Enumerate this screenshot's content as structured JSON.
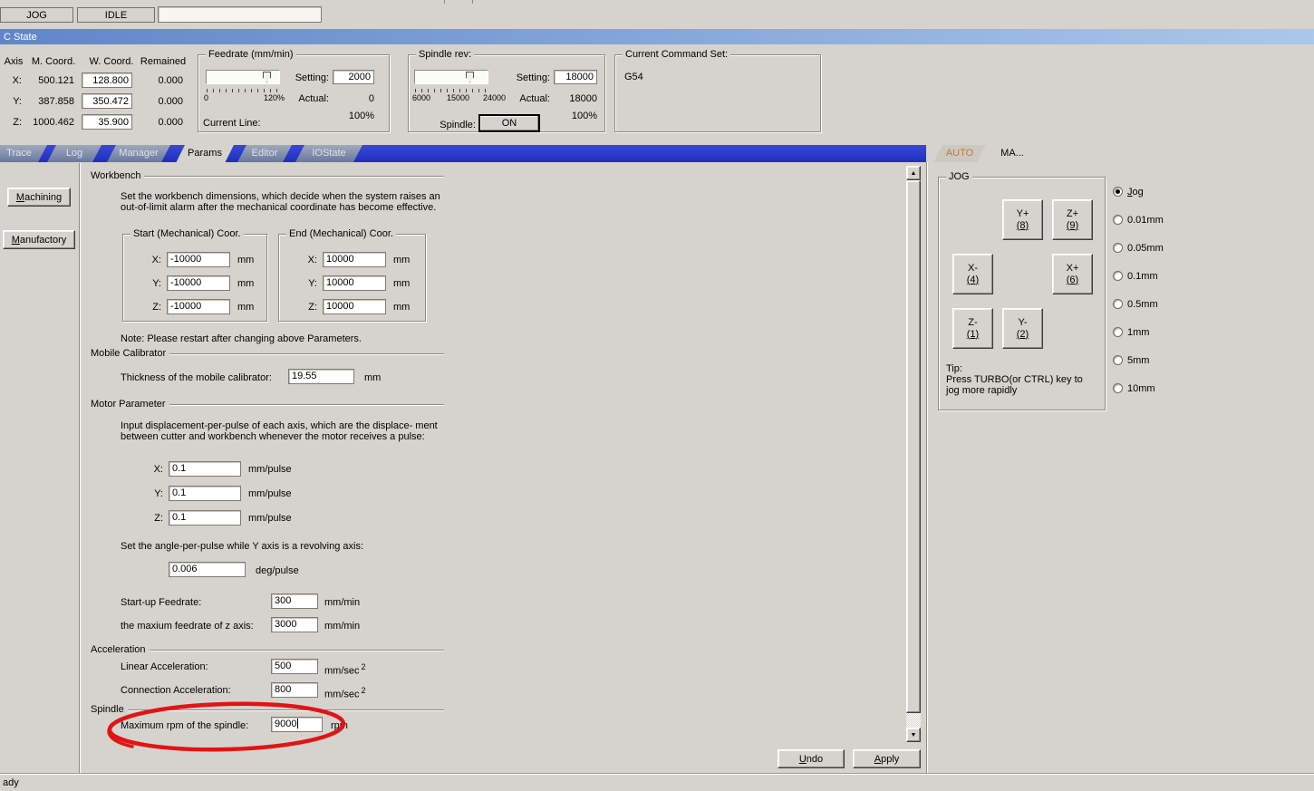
{
  "topbar": {
    "jog": "JOG",
    "idle": "IDLE",
    "input": ""
  },
  "titlebar": {
    "title": "C State"
  },
  "coord_panel": {
    "headers": {
      "axis": "Axis",
      "m": "M. Coord.",
      "w": "W. Coord.",
      "r": "Remained"
    },
    "rows": [
      {
        "axis": "X:",
        "m": "500.121",
        "w": "128.800",
        "r": "0.000"
      },
      {
        "axis": "Y:",
        "m": "387.858",
        "w": "350.472",
        "r": "0.000"
      },
      {
        "axis": "Z:",
        "m": "1000.462",
        "w": "35.900",
        "r": "0.000"
      }
    ]
  },
  "feedrate": {
    "group": "Feedrate (mm/min)",
    "setting_label": "Setting:",
    "setting": "2000",
    "actual_label": "Actual:",
    "actual": "0",
    "percent": "100%",
    "scale_min": "0",
    "scale_max": "120%",
    "current_line": "Current Line:"
  },
  "spindle_panel": {
    "group": "Spindle rev:",
    "setting_label": "Setting:",
    "setting": "18000",
    "actual_label": "Actual:",
    "actual": "18000",
    "percent": "100%",
    "scale": [
      "6000",
      "15000",
      "24000"
    ],
    "spindle_label": "Spindle:",
    "on": "ON"
  },
  "command": {
    "group": "Current Command Set:",
    "value": "G54"
  },
  "tabs": [
    {
      "label": "Trace"
    },
    {
      "label": "Log"
    },
    {
      "label": "Manager"
    },
    {
      "label": "Params",
      "active": true
    },
    {
      "label": "Editor"
    },
    {
      "label": "IOState"
    }
  ],
  "sidebar": {
    "machining": "Machining",
    "manufactory": "Manufactory"
  },
  "params": {
    "workbench": {
      "title": "Workbench",
      "desc1": "Set the workbench dimensions, which decide when the system raises an",
      "desc2": "out-of-limit alarm after the mechanical coordinate has become effective.",
      "start_group": "Start (Mechanical) Coor.",
      "end_group": "End (Mechanical) Coor.",
      "axis_labels": [
        "X:",
        "Y:",
        "Z:"
      ],
      "start_values": [
        "-10000",
        "-10000",
        "-10000"
      ],
      "end_values": [
        "10000",
        "10000",
        "10000"
      ],
      "unit": "mm",
      "note": "Note: Please restart after changing above Parameters."
    },
    "calibrator": {
      "title": "Mobile Calibrator",
      "label": "Thickness of the mobile calibrator:",
      "value": "19.55",
      "unit": "mm"
    },
    "motor": {
      "title": "Motor Parameter",
      "desc1": "Input displacement-per-pulse of each axis, which are the displace- ment",
      "desc2": "between cutter and workbench whenever the motor receives a pulse:",
      "axis_labels": [
        "X:",
        "Y:",
        "Z:"
      ],
      "values": [
        "0.1",
        "0.1",
        "0.1"
      ],
      "unit": "mm/pulse",
      "angle_label": "Set the angle-per-pulse while Y axis is a revolving axis:",
      "angle_value": "0.006",
      "angle_unit": "deg/pulse",
      "startup_label": "Start-up Feedrate:",
      "startup_value": "300",
      "startup_unit": "mm/min",
      "zmax_label": "the maxium feedrate of z axis:",
      "zmax_value": "3000",
      "zmax_unit": "mm/min"
    },
    "acceleration": {
      "title": "Acceleration",
      "linear_label": "Linear Acceleration:",
      "linear_value": "500",
      "connection_label": "Connection Acceleration:",
      "connection_value": "800",
      "unit": "mm/sec",
      "unit_sup": "2"
    },
    "spindle": {
      "title": "Spindle",
      "label": "Maximum rpm of the spindle:",
      "value": "9000",
      "unit": "rpm"
    },
    "undo": "Undo",
    "apply": "Apply"
  },
  "right_panel": {
    "tabs": [
      {
        "label": "AUTO"
      },
      {
        "label": "MA...",
        "active": true
      }
    ],
    "jog": {
      "group": "JOG",
      "buttons": [
        {
          "axis": "Y+",
          "key": "(8)"
        },
        {
          "axis": "Z+",
          "key": "(9)"
        },
        {
          "axis": "X-",
          "key": "(4)"
        },
        {
          "axis": "X+",
          "key": "(6)"
        },
        {
          "axis": "Z-",
          "key": "(1)"
        },
        {
          "axis": "Y-",
          "key": "(2)"
        }
      ],
      "tip1": "Tip:",
      "tip2": "Press TURBO(or CTRL) key to",
      "tip3": "jog more rapidly"
    },
    "steps": [
      {
        "label": "Jog",
        "selected": true
      },
      {
        "label": "0.01mm"
      },
      {
        "label": "0.05mm"
      },
      {
        "label": "0.1mm"
      },
      {
        "label": "0.5mm"
      },
      {
        "label": "1mm"
      },
      {
        "label": "5mm"
      },
      {
        "label": "10mm"
      }
    ]
  },
  "statusbar": {
    "text": "ady"
  },
  "colors": {
    "annotation": "#e11414",
    "tabbar_blue": "#2838cc",
    "auto_tab_text": "#c07830"
  }
}
